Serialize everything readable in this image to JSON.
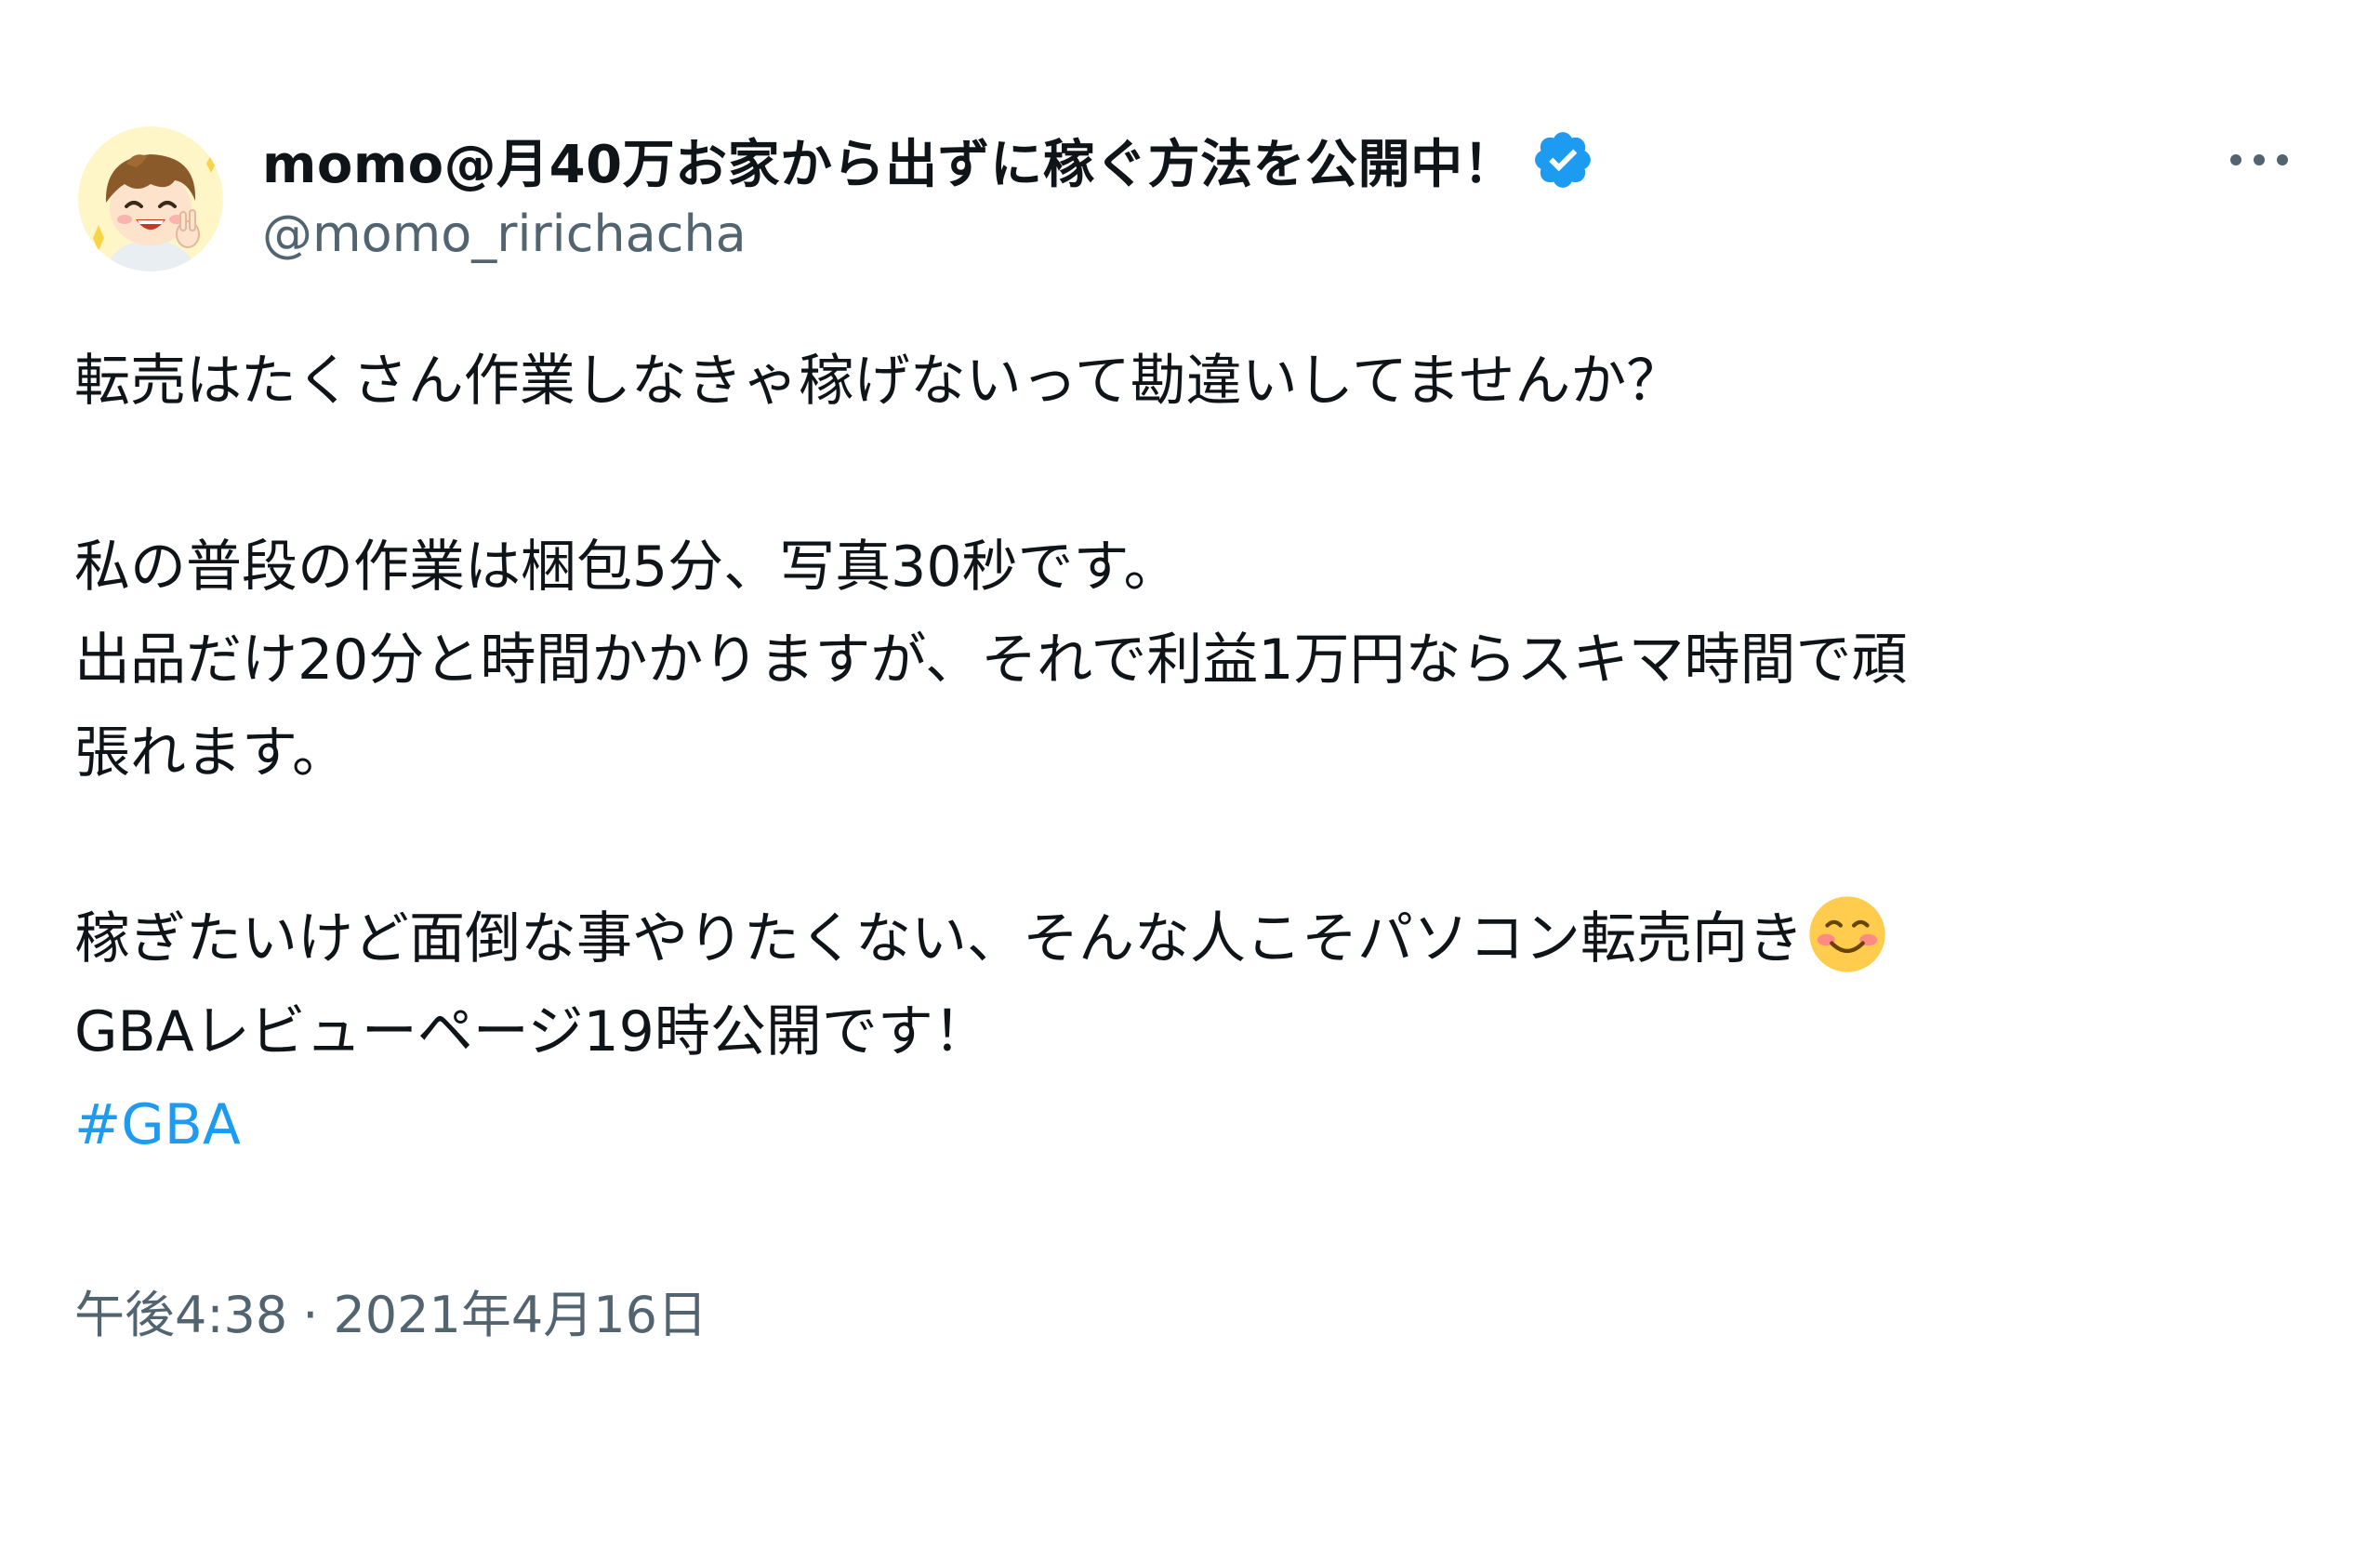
{
  "author": {
    "display_name": "momo@月40万お家から出ずに稼ぐ方法を公開中！",
    "handle": "@momo_ririchacha",
    "verified": true,
    "avatar_icon": "avatar-cartoon-boy-icon",
    "badge_color": "#1d9bf0"
  },
  "more_icon": "more-horizontal-icon",
  "body": {
    "line1": "転売はたくさん作業しなきゃ稼げないって勘違いしてませんか？",
    "line2": "私の普段の作業は梱包5分、写真30秒です。",
    "line3": "出品だけ20分と時間かかりますが、それで利益1万円ならスキマ時間で頑",
    "line4": "張れます。",
    "line5": "稼ぎたいけど面倒な事やりたくない、そんな人こそパソコン転売向き",
    "line5_emoji": "smiling-face-emoji",
    "line6": "GBAレビューページ19時公開です！",
    "hashtag": "#GBA",
    "hashtag_color": "#1d9bf0"
  },
  "meta": {
    "time": "午後4:38",
    "separator": "·",
    "date": "2021年4月16日"
  }
}
